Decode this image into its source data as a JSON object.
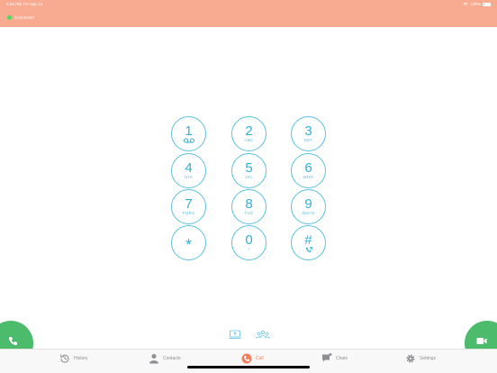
{
  "status_bar": {
    "time": "2:44 PM",
    "date": "Fri Sep 13",
    "battery": "100%"
  },
  "connection": {
    "label": "Connected",
    "color": "#4cd964"
  },
  "colors": {
    "header": "#f9ab92",
    "accent": "#f37f60",
    "key_outline": "#5bc0de",
    "call_green": "#4cbb6c"
  },
  "keypad": [
    {
      "digit": "1",
      "letters": "",
      "sub_icon": "voicemail-icon"
    },
    {
      "digit": "2",
      "letters": "ABC"
    },
    {
      "digit": "3",
      "letters": "DEF"
    },
    {
      "digit": "4",
      "letters": "GHI"
    },
    {
      "digit": "5",
      "letters": "JKL"
    },
    {
      "digit": "6",
      "letters": "MNO"
    },
    {
      "digit": "7",
      "letters": "PQRS"
    },
    {
      "digit": "8",
      "letters": "TUV"
    },
    {
      "digit": "9",
      "letters": "WXYZ"
    },
    {
      "digit": "*",
      "letters": ""
    },
    {
      "digit": "0",
      "letters": "+"
    },
    {
      "digit": "#",
      "letters": "",
      "sub_icon": "phone-forward-icon"
    }
  ],
  "tabs": [
    {
      "label": "History",
      "icon": "history-icon",
      "active": false
    },
    {
      "label": "Contacts",
      "icon": "contacts-icon",
      "active": false
    },
    {
      "label": "Call",
      "icon": "call-icon",
      "active": true
    },
    {
      "label": "Chats",
      "icon": "chats-icon",
      "active": false
    },
    {
      "label": "Settings",
      "icon": "gear-icon",
      "active": false
    }
  ]
}
